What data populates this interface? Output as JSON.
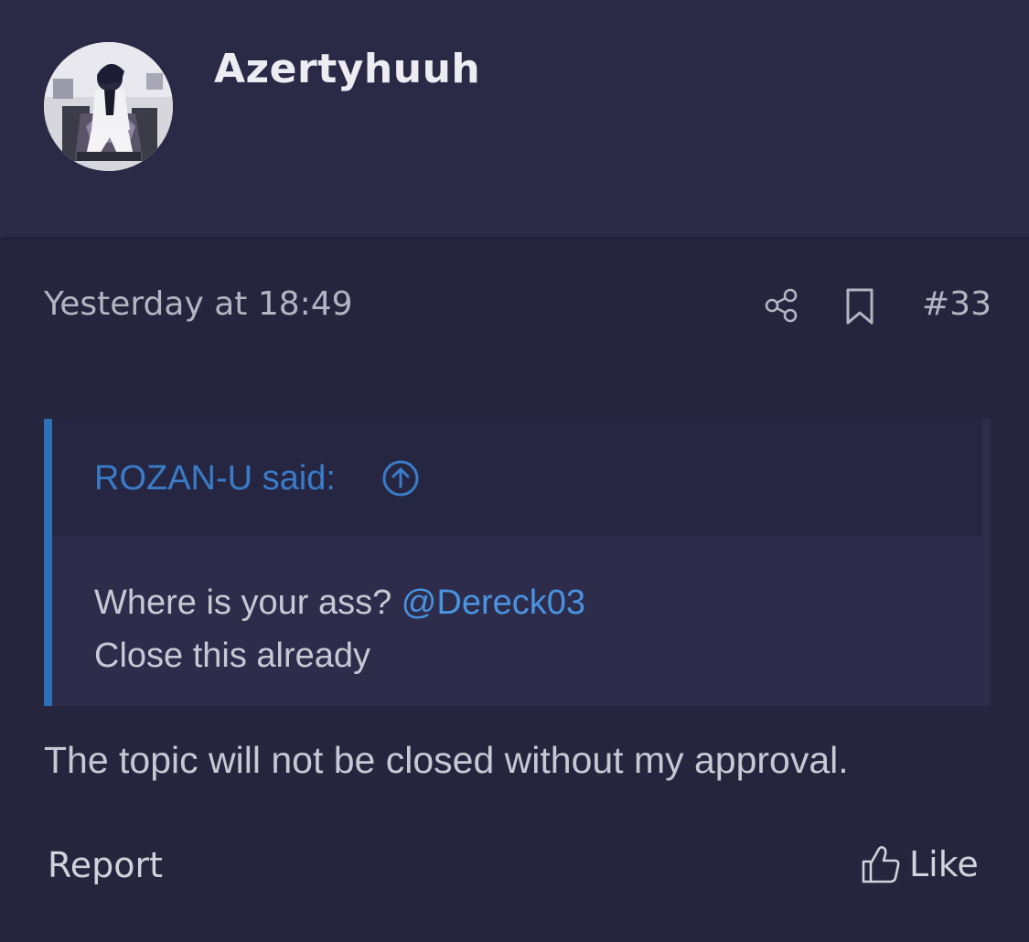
{
  "author": {
    "username": "Azertyhuuh",
    "avatar_icon": "user-avatar"
  },
  "post": {
    "timestamp": "Yesterday at 18:49",
    "number": "#33",
    "share_icon": "share-icon",
    "bookmark_icon": "bookmark-icon"
  },
  "quote": {
    "author_label": "ROZAN-U said:",
    "arrow_icon": "arrow-up-circle-icon",
    "line1_text": "Where is your ass?",
    "mention": "@Dereck03",
    "line2_text": "Close this already"
  },
  "message": "The topic will not be closed without my approval.",
  "actions": {
    "report_label": "Report",
    "like_label": "Like",
    "like_icon": "thumbs-up-icon"
  },
  "colors": {
    "header_bg": "#2a2a47",
    "post_bg": "#25253e",
    "quote_bg": "#2d2d4b",
    "quote_border": "#2f6fb8",
    "link": "#3a7cc8",
    "mention": "#4a93e0",
    "text": "#c8c8d4"
  }
}
